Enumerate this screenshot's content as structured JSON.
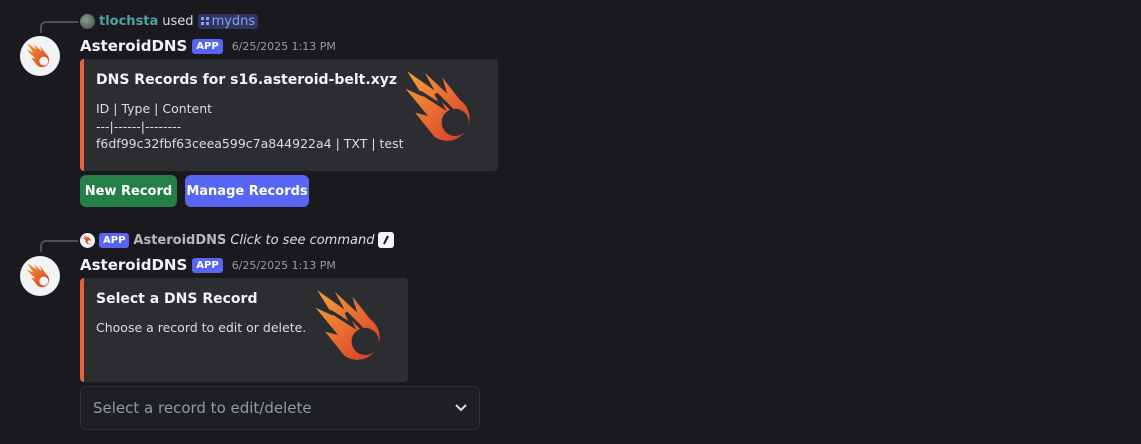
{
  "message1": {
    "reply": {
      "user": "tlochsta",
      "verb": "used",
      "command": "mydns"
    },
    "author": "AsteroidDNS",
    "app_tag": "APP",
    "timestamp": "6/25/2025 1:13 PM",
    "embed": {
      "title": "DNS Records for s16.asteroid-belt.xyz",
      "lines": [
        "ID | Type | Content",
        "---|------|--------",
        "f6df99c32fbf63ceea599c7a844922a4 | TXT | test"
      ],
      "thumbnail_icon": "comet-icon",
      "accent_color": "#e8623a"
    },
    "buttons": {
      "new_record": "New Record",
      "manage_records": "Manage Records"
    }
  },
  "message2": {
    "reply": {
      "app_tag": "APP",
      "bot": "AsteroidDNS",
      "hint": "Click to see command",
      "icon": "slash-command-icon"
    },
    "author": "AsteroidDNS",
    "app_tag": "APP",
    "timestamp": "6/25/2025 1:13 PM",
    "embed": {
      "title": "Select a DNS Record",
      "description": "Choose a record to edit or delete.",
      "thumbnail_icon": "comet-icon",
      "accent_color": "#e8623a"
    },
    "select": {
      "placeholder": "Select a record to edit/delete",
      "icon": "chevron-down-icon"
    }
  }
}
